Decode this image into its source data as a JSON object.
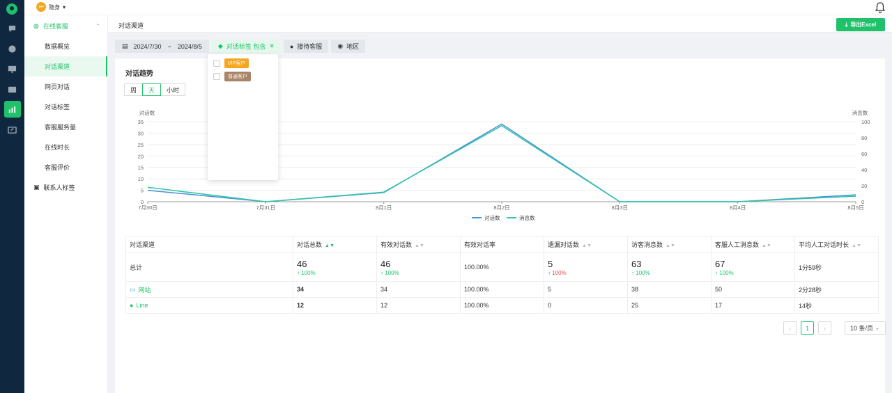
{
  "topbar": {
    "status_label": "隐身"
  },
  "sidebar": {
    "group_label": "在线客服",
    "items": [
      {
        "label": "数据概览"
      },
      {
        "label": "对话渠道"
      },
      {
        "label": "网页对话"
      },
      {
        "label": "对话标签"
      },
      {
        "label": "客服服务量"
      },
      {
        "label": "在线时长"
      },
      {
        "label": "客服评价"
      }
    ],
    "group2_label": "联系人标签"
  },
  "header": {
    "title": "对话渠道",
    "export_label": "导出Excel"
  },
  "filters": {
    "date_start": "2024/7/30",
    "date_sep": "~",
    "date_end": "2024/8/5",
    "tag_filter": "对话标签 包含",
    "agent": "接待客服",
    "region": "地区"
  },
  "dropdown": {
    "options": [
      {
        "label": "VIP客户",
        "color": "#f5a623"
      },
      {
        "label": "普通客户",
        "color": "#a98467"
      }
    ]
  },
  "trend": {
    "title": "对话趋势",
    "segments": [
      "周",
      "天",
      "小时"
    ],
    "active_segment": "天"
  },
  "chart_data": {
    "type": "line",
    "categories": [
      "7月30日",
      "7月31日",
      "8月1日",
      "8月2日",
      "8月3日",
      "8月4日",
      "8月5日"
    ],
    "y_left_label": "对话数",
    "y_right_label": "消息数",
    "y_left_ticks": [
      0,
      5,
      10,
      15,
      20,
      25,
      30,
      35
    ],
    "y_right_ticks": [
      0,
      20,
      40,
      60,
      80,
      100
    ],
    "ylim_left": [
      0,
      35
    ],
    "ylim_right": [
      0,
      100
    ],
    "series": [
      {
        "name": "对话数",
        "axis": "left",
        "color": "#4a90d9",
        "values": [
          5,
          0,
          4,
          34,
          0,
          0,
          3
        ]
      },
      {
        "name": "消息数",
        "axis": "right",
        "color": "#2ec4a6",
        "values": [
          18,
          0,
          12,
          95,
          0,
          0,
          7
        ]
      }
    ],
    "legend": "bottom-center",
    "grid": true
  },
  "table": {
    "headers": [
      "对话渠道",
      "对话总数",
      "有效对话数",
      "有效对话率",
      "遗漏对话数",
      "访客消息数",
      "客服人工消息数",
      "平均人工对话时长"
    ],
    "total": {
      "label": "总计",
      "cells": [
        {
          "value": "46",
          "change": "↑ 100%"
        },
        {
          "value": "46",
          "change": "↑ 100%"
        },
        {
          "value": "100.00%"
        },
        {
          "value": "5",
          "change": "↑ 100%"
        },
        {
          "value": "63",
          "change": "↑ 100%"
        },
        {
          "value": "67",
          "change": "↑ 100%"
        },
        {
          "value": "1分59秒"
        }
      ]
    },
    "rows": [
      {
        "source": "网站",
        "cells": [
          "34",
          "34",
          "100.00%",
          "5",
          "38",
          "50",
          "2分28秒"
        ]
      },
      {
        "source": "Line",
        "cells": [
          "12",
          "12",
          "100.00%",
          "0",
          "25",
          "17",
          "14秒"
        ]
      }
    ]
  },
  "pagination": {
    "prev": "‹",
    "current": "1",
    "next": "›",
    "page_size": "10 条/页"
  }
}
